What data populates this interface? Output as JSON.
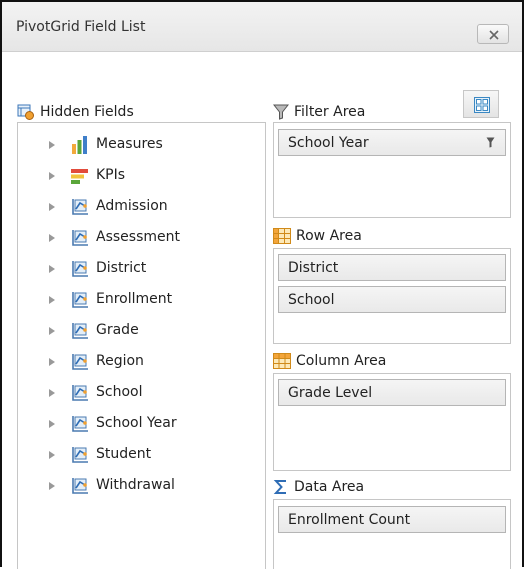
{
  "window": {
    "title": "PivotGrid Field List",
    "close_icon": "close-x-icon"
  },
  "toolbar": {
    "layout_icon": "layout-grid-icon"
  },
  "hidden_fields": {
    "header": "Hidden Fields",
    "icon": "hidden-fields-icon",
    "items": [
      {
        "label": "Measures",
        "icon": "measures-bar-chart-icon"
      },
      {
        "label": "KPIs",
        "icon": "kpi-bars-icon"
      },
      {
        "label": "Admission",
        "icon": "dimension-icon"
      },
      {
        "label": "Assessment",
        "icon": "dimension-icon"
      },
      {
        "label": "District",
        "icon": "dimension-icon"
      },
      {
        "label": "Enrollment",
        "icon": "dimension-icon"
      },
      {
        "label": "Grade",
        "icon": "dimension-icon"
      },
      {
        "label": "Region",
        "icon": "dimension-icon"
      },
      {
        "label": "School",
        "icon": "dimension-icon"
      },
      {
        "label": "School Year",
        "icon": "dimension-icon"
      },
      {
        "label": "Student",
        "icon": "dimension-icon"
      },
      {
        "label": "Withdrawal",
        "icon": "dimension-icon"
      }
    ]
  },
  "filter_area": {
    "header": "Filter Area",
    "icon": "funnel-icon",
    "fields": [
      {
        "label": "School Year",
        "icon": "filter-icon"
      }
    ]
  },
  "row_area": {
    "header": "Row Area",
    "icon": "row-grid-icon",
    "fields": [
      {
        "label": "District"
      },
      {
        "label": "School"
      }
    ]
  },
  "column_area": {
    "header": "Column Area",
    "icon": "column-grid-icon",
    "fields": [
      {
        "label": "Grade Level"
      }
    ]
  },
  "data_area": {
    "header": "Data Area",
    "icon": "sigma-icon",
    "fields": [
      {
        "label": "Enrollment Count"
      }
    ]
  }
}
